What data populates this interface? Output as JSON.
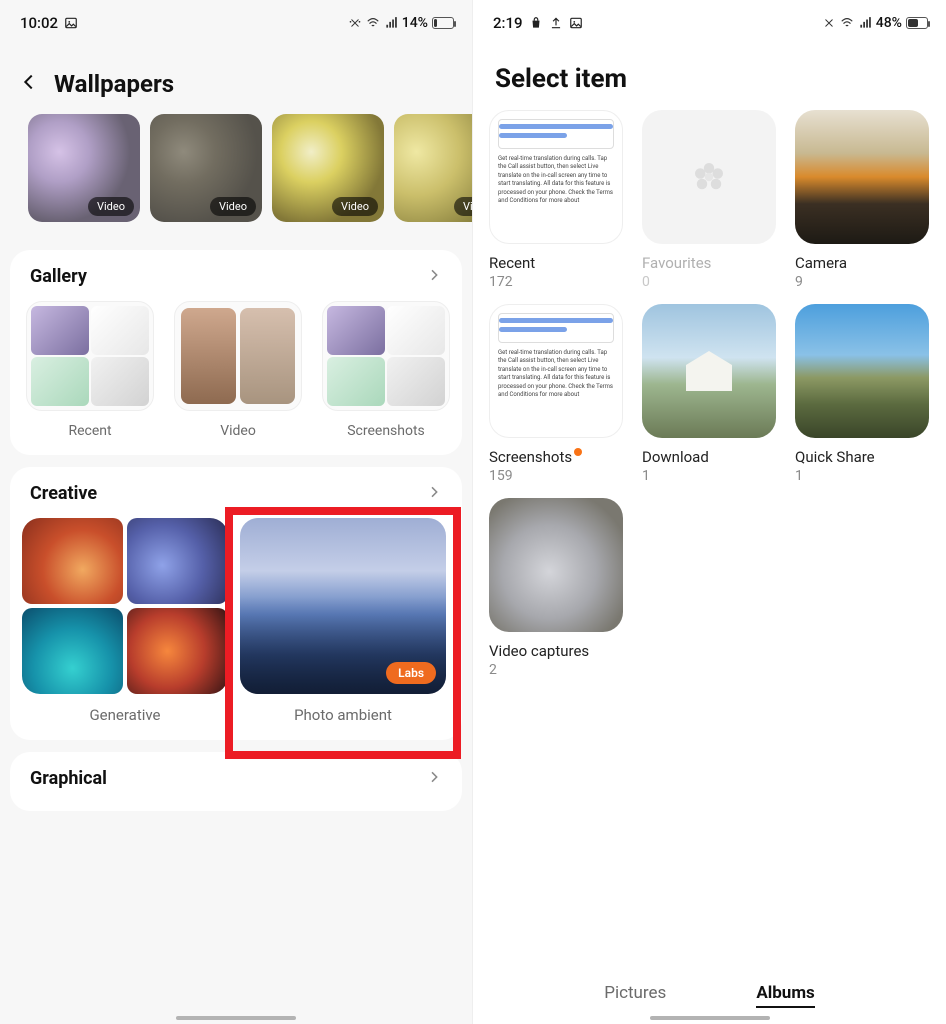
{
  "left": {
    "status": {
      "time": "10:02",
      "battery_text": "14%",
      "battery_fill": 14
    },
    "header": {
      "title": "Wallpapers"
    },
    "video_strip": {
      "badge": "Video"
    },
    "gallery": {
      "title": "Gallery",
      "items": [
        {
          "label": "Recent"
        },
        {
          "label": "Video"
        },
        {
          "label": "Screenshots"
        }
      ]
    },
    "creative": {
      "title": "Creative",
      "items": [
        {
          "label": "Generative"
        },
        {
          "label": "Photo ambient",
          "badge": "Labs"
        }
      ]
    },
    "graphical": {
      "title": "Graphical"
    }
  },
  "right": {
    "status": {
      "time": "2:19",
      "battery_text": "48%",
      "battery_fill": 48
    },
    "header": {
      "title": "Select item"
    },
    "albums": [
      {
        "name": "Recent",
        "count": "172"
      },
      {
        "name": "Favourites",
        "count": "0"
      },
      {
        "name": "Camera",
        "count": "9"
      },
      {
        "name": "Screenshots",
        "count": "159",
        "dot": true
      },
      {
        "name": "Download",
        "count": "1"
      },
      {
        "name": "Quick Share",
        "count": "1"
      },
      {
        "name": "Video captures",
        "count": "2"
      }
    ],
    "tabs": {
      "pictures": "Pictures",
      "albums": "Albums"
    }
  }
}
